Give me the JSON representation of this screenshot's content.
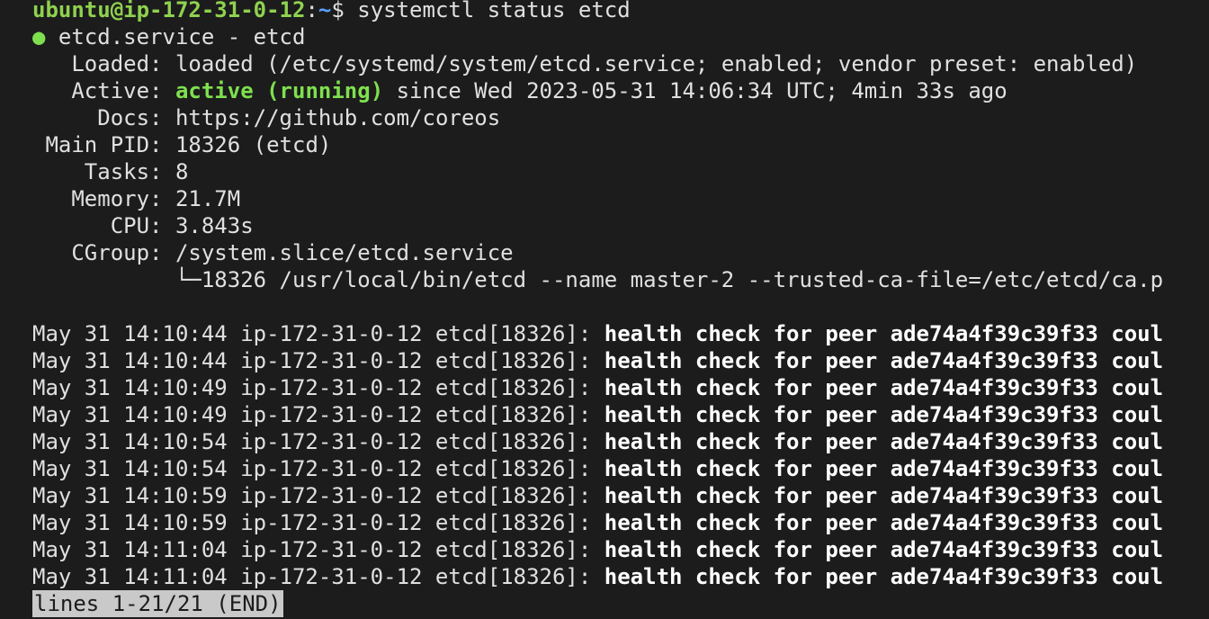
{
  "prompt": {
    "user_host": "ubuntu@ip-172-31-0-12",
    "colon": ":",
    "path": "~",
    "symbol": "$ ",
    "command": "systemctl status etcd"
  },
  "service": {
    "bullet": "●",
    "title": " etcd.service - etcd"
  },
  "status": {
    "loaded_key": "   Loaded: ",
    "loaded_value": "loaded (/etc/systemd/system/etcd.service; enabled; vendor preset: enabled)",
    "active_key": "   Active: ",
    "active_state": "active (running)",
    "active_since": " since Wed 2023-05-31 14:06:34 UTC; 4min 33s ago",
    "docs_key": "     Docs: ",
    "docs_value": "https://github.com/coreos",
    "pid_key": " Main PID: ",
    "pid_value": "18326 (etcd)",
    "tasks_key": "    Tasks: ",
    "tasks_value": "8",
    "memory_key": "   Memory: ",
    "memory_value": "21.7M",
    "cpu_key": "      CPU: ",
    "cpu_value": "3.843s",
    "cgroup_key": "   CGroup: ",
    "cgroup_value": "/system.slice/etcd.service",
    "process_line": "           └─18326 /usr/local/bin/etcd --name master-2 --trusted-ca-file=/etc/etcd/ca.p"
  },
  "logs": [
    {
      "prefix": "May 31 14:10:44 ip-172-31-0-12 etcd[18326]: ",
      "message": "health check for peer ade74a4f39c39f33 coul"
    },
    {
      "prefix": "May 31 14:10:44 ip-172-31-0-12 etcd[18326]: ",
      "message": "health check for peer ade74a4f39c39f33 coul"
    },
    {
      "prefix": "May 31 14:10:49 ip-172-31-0-12 etcd[18326]: ",
      "message": "health check for peer ade74a4f39c39f33 coul"
    },
    {
      "prefix": "May 31 14:10:49 ip-172-31-0-12 etcd[18326]: ",
      "message": "health check for peer ade74a4f39c39f33 coul"
    },
    {
      "prefix": "May 31 14:10:54 ip-172-31-0-12 etcd[18326]: ",
      "message": "health check for peer ade74a4f39c39f33 coul"
    },
    {
      "prefix": "May 31 14:10:54 ip-172-31-0-12 etcd[18326]: ",
      "message": "health check for peer ade74a4f39c39f33 coul"
    },
    {
      "prefix": "May 31 14:10:59 ip-172-31-0-12 etcd[18326]: ",
      "message": "health check for peer ade74a4f39c39f33 coul"
    },
    {
      "prefix": "May 31 14:10:59 ip-172-31-0-12 etcd[18326]: ",
      "message": "health check for peer ade74a4f39c39f33 coul"
    },
    {
      "prefix": "May 31 14:11:04 ip-172-31-0-12 etcd[18326]: ",
      "message": "health check for peer ade74a4f39c39f33 coul"
    },
    {
      "prefix": "May 31 14:11:04 ip-172-31-0-12 etcd[18326]: ",
      "message": "health check for peer ade74a4f39c39f33 coul"
    }
  ],
  "pager": {
    "status": "lines 1-21/21 (END)"
  },
  "colors": {
    "background": "#1c1c1c",
    "foreground": "#e0e0e0",
    "prompt_user": "#8fd14f",
    "prompt_path": "#5aa0ff",
    "active": "#7ee04e",
    "pager_bg": "#c9c9c9"
  }
}
